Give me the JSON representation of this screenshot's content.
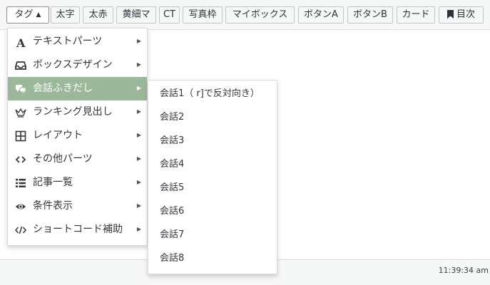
{
  "toolbar": {
    "buttons": [
      {
        "label": "タグ",
        "active": true,
        "caret": "▲"
      },
      {
        "label": "太字"
      },
      {
        "label": "太赤"
      },
      {
        "label": "黄細マ"
      },
      {
        "label": "CT"
      },
      {
        "label": "写真枠"
      },
      {
        "label": "マイボックス"
      },
      {
        "label": "ボタンA"
      },
      {
        "label": "ボタンB"
      },
      {
        "label": "カード"
      },
      {
        "label": "目次",
        "icon": "bookmark-icon"
      }
    ]
  },
  "menu": {
    "items": [
      {
        "label": "テキストパーツ",
        "icon": "letter-a-icon"
      },
      {
        "label": "ボックスデザイン",
        "icon": "inbox-tray-icon"
      },
      {
        "label": "会話ふきだし",
        "icon": "speech-bubbles-icon",
        "highlighted": true
      },
      {
        "label": "ランキング見出し",
        "icon": "crown-icon"
      },
      {
        "label": "レイアウト",
        "icon": "grid-icon"
      },
      {
        "label": "その他パーツ",
        "icon": "code-brackets-icon"
      },
      {
        "label": "記事一覧",
        "icon": "list-icon"
      },
      {
        "label": "条件表示",
        "icon": "eye-icon"
      },
      {
        "label": "ショートコード補助",
        "icon": "code-slash-icon"
      }
    ],
    "arrow": "▶"
  },
  "submenu": {
    "items": [
      "会話1（ r]で反対向き）",
      "会話2",
      "会話3",
      "会話4",
      "会話5",
      "会話6",
      "会話7",
      "会話8"
    ]
  },
  "status": {
    "time": "11:39:34 am"
  },
  "colors": {
    "highlight": "#9cb89b",
    "toolbar_bg": "#f6f7f7",
    "border": "#dcdcde"
  }
}
